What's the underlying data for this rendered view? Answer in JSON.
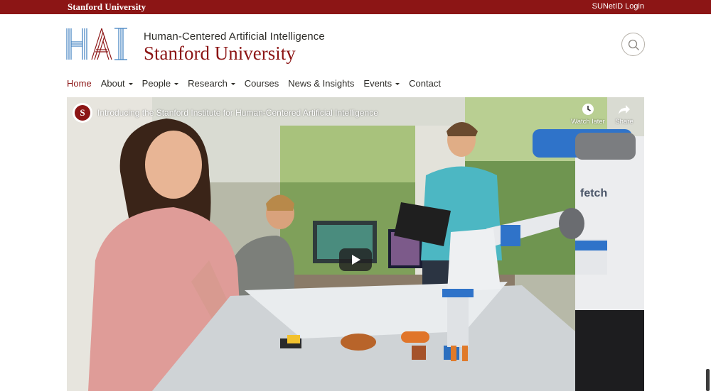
{
  "topbar": {
    "brand": "Stanford University",
    "login": "SUNetID Login"
  },
  "logo": {
    "mark_text": "HAI",
    "line1": "Human-Centered Artificial Intelligence",
    "line2": "Stanford University"
  },
  "search": {
    "icon": "search-icon"
  },
  "nav": {
    "items": [
      {
        "label": "Home",
        "active": true,
        "dropdown": false
      },
      {
        "label": "About",
        "dropdown": true
      },
      {
        "label": "People",
        "dropdown": true
      },
      {
        "label": "Research",
        "dropdown": true
      },
      {
        "label": "Courses",
        "dropdown": false
      },
      {
        "label": "News & Insights",
        "dropdown": false
      },
      {
        "label": "Events",
        "dropdown": true
      },
      {
        "label": "Contact",
        "dropdown": false
      }
    ]
  },
  "video": {
    "title": "Introducing the Stanford Institute for Human-Centered Artificial Intelligence",
    "channel_avatar_letter": "S",
    "watch_later": "Watch later",
    "share": "Share",
    "robot_brand": "fetch"
  },
  "colors": {
    "cardinal": "#8c1515",
    "text": "#2e2d29",
    "logo_blue": "#3d7fbf"
  }
}
